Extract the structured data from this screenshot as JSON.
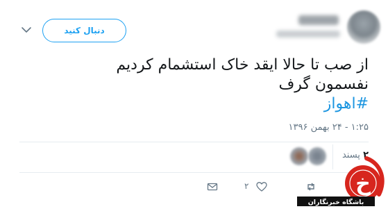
{
  "tweet": {
    "follow_label": "دنبال کنید",
    "text_line1": "از صب تا حالا ایقد خاک استشمام کردیم",
    "text_line2": "نفسمون گرف",
    "hashtag": "#اهواز",
    "timestamp": "۱:۲۵ - ۲۴ بهمن ۱۳۹۶",
    "likes_count": "۲",
    "likes_label": "پسند",
    "like_action_count": "۲"
  },
  "icons": {
    "chevron": "chevron-down-icon",
    "reply": "reply-icon",
    "like": "heart-icon",
    "retweet": "retweet-icon",
    "dm": "envelope-icon"
  },
  "watermark": {
    "text": "باشگاه خبرنگاران",
    "logo_letter": "خ"
  },
  "colors": {
    "accent": "#1da1f2",
    "hashtag": "#1b95e0",
    "muted": "#657786",
    "logo_red": "#d7261e"
  }
}
